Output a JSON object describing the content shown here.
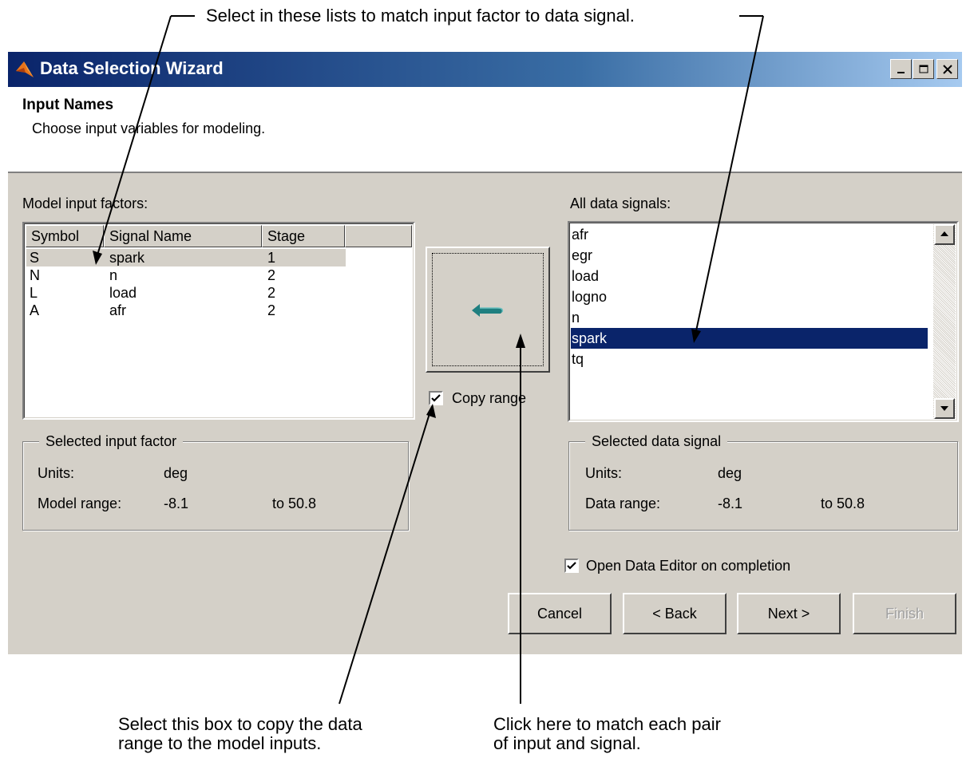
{
  "callouts": {
    "top": "Select in these lists to match input factor to data signal.",
    "bottom_left_line1": "Select this box to copy the data",
    "bottom_left_line2": "range to the model inputs.",
    "bottom_right_line1": "Click here to match each pair",
    "bottom_right_line2": "of input and signal."
  },
  "window": {
    "title": "Data Selection Wizard",
    "header_title": "Input Names",
    "header_subtitle": "Choose input variables for modeling.",
    "title_gradient": [
      "#0a246a",
      "#a6caf0"
    ]
  },
  "factors": {
    "label": "Model input factors:",
    "columns": [
      "Symbol",
      "Signal Name",
      "Stage"
    ],
    "rows": [
      {
        "symbol": "S",
        "signal": "spark",
        "stage": "1",
        "selected": true
      },
      {
        "symbol": "N",
        "signal": "n",
        "stage": "2",
        "selected": false
      },
      {
        "symbol": "L",
        "signal": "load",
        "stage": "2",
        "selected": false
      },
      {
        "symbol": "A",
        "signal": "afr",
        "stage": "2",
        "selected": false
      }
    ]
  },
  "selected_factor": {
    "title": "Selected input factor",
    "units_label": "Units:",
    "units_value": "deg",
    "range_label": "Model range:",
    "range_min": "-8.1",
    "range_max": "to  50.8"
  },
  "match_button": {
    "icon": "left-arrow-icon"
  },
  "copy_range": {
    "label": "Copy range",
    "checked": true
  },
  "signals": {
    "label": "All data signals:",
    "items": [
      "afr",
      "egr",
      "load",
      "logno",
      "n",
      "spark",
      "tq"
    ],
    "selected": "spark"
  },
  "selected_signal": {
    "title": "Selected data signal",
    "units_label": "Units:",
    "units_value": "deg",
    "range_label": "Data range:",
    "range_min": "-8.1",
    "range_max": "to  50.8"
  },
  "open_editor": {
    "label": "Open Data Editor on completion",
    "checked": true
  },
  "buttons": {
    "cancel": "Cancel",
    "back": "< Back",
    "next": "Next >",
    "finish": "Finish"
  },
  "colors": {
    "selection": "#0a246a",
    "face": "#d4d0c8"
  }
}
